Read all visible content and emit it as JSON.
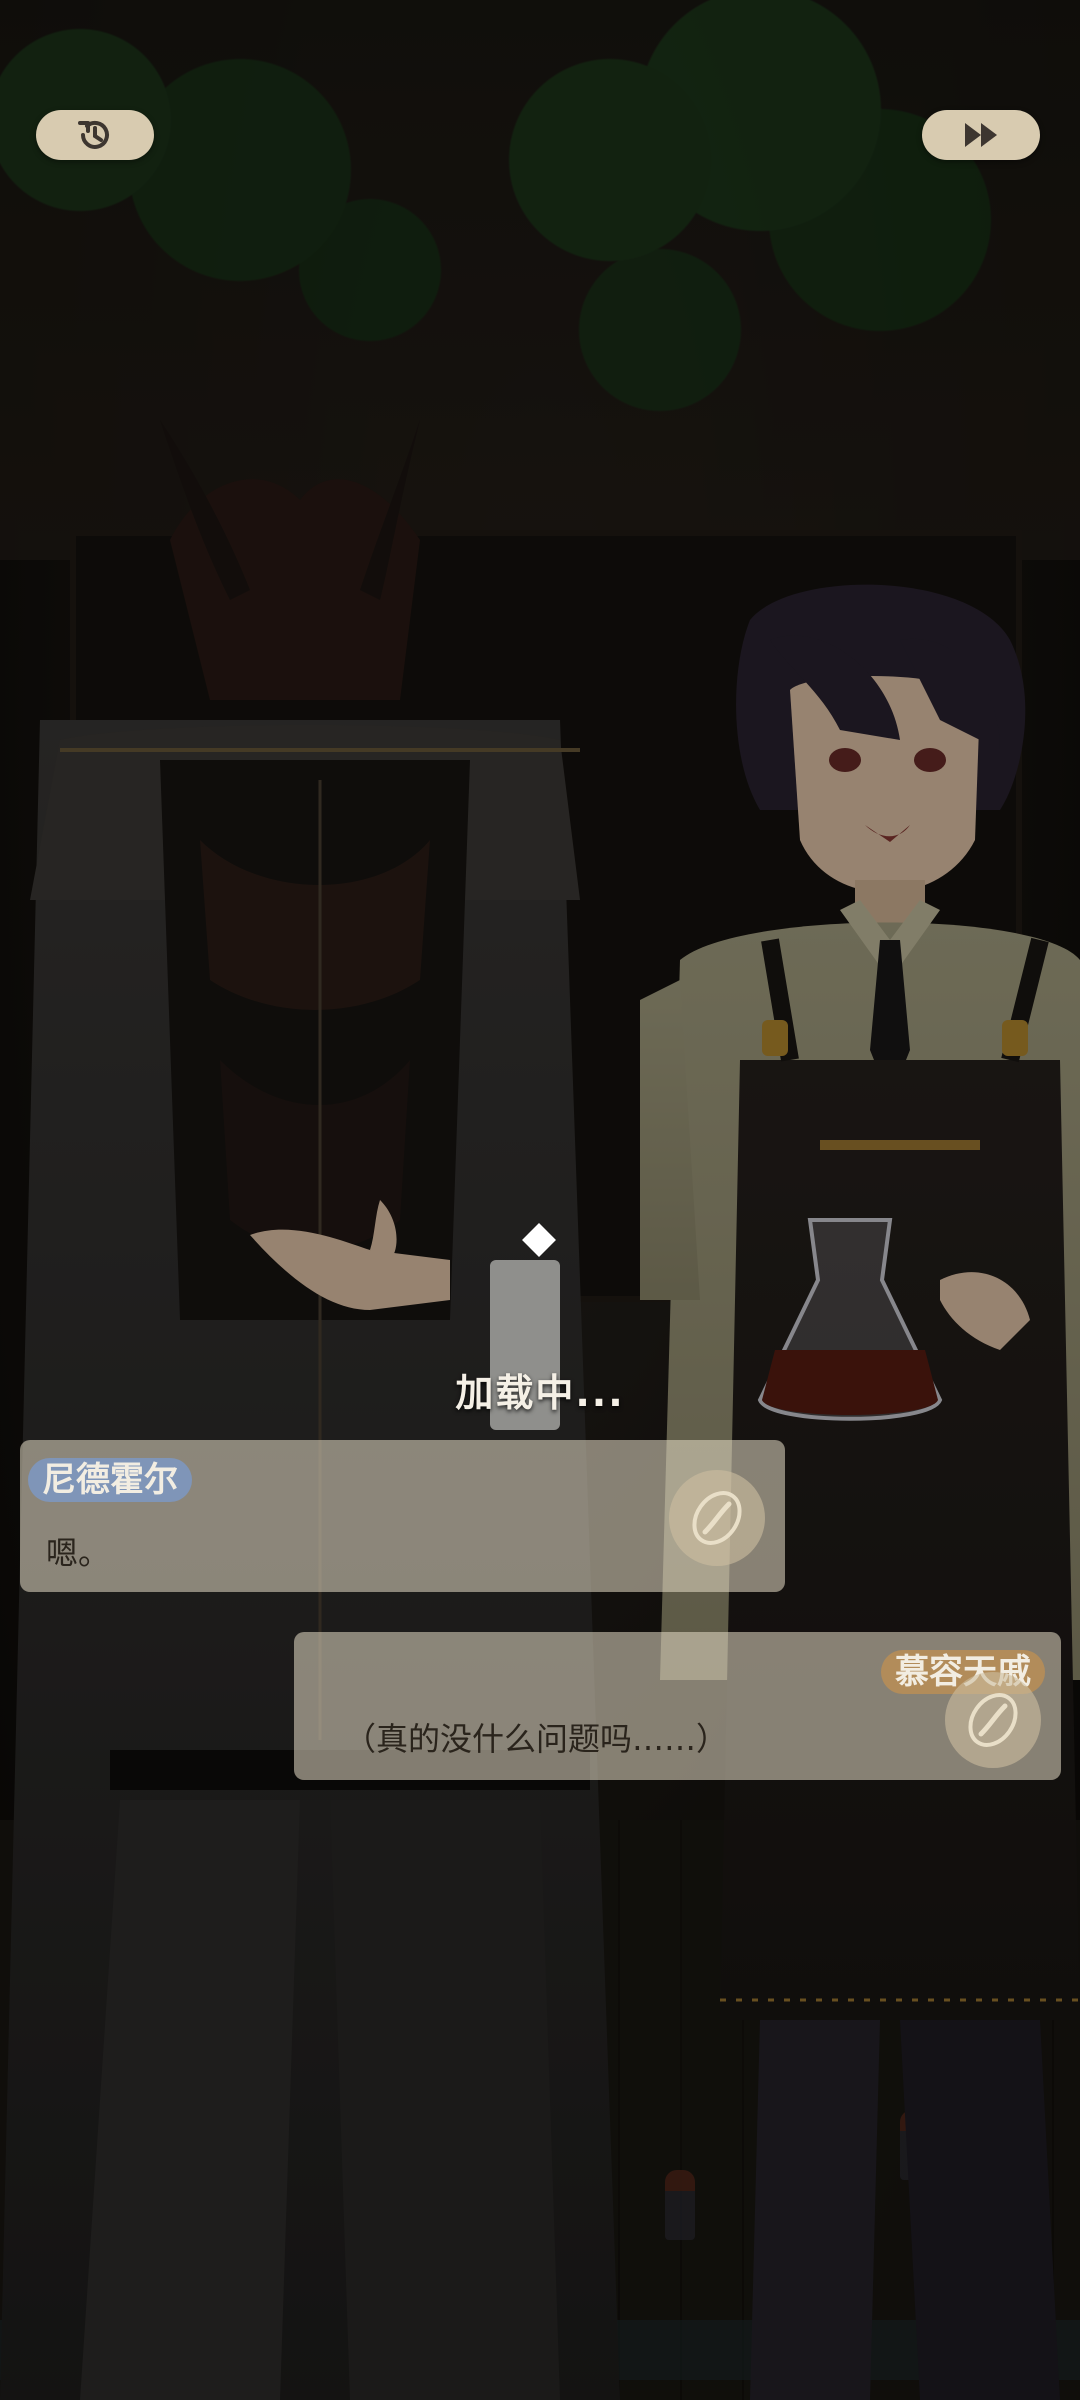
{
  "topbar": {
    "history_icon": "history-icon",
    "skip_icon": "fast-forward-icon"
  },
  "loading": {
    "text": "加载中..."
  },
  "dialogues": [
    {
      "speaker": "尼德霍尔",
      "text": "嗯。",
      "name_color": "#7f95b8"
    },
    {
      "speaker": "慕容天戚",
      "text": "（真的没什么问题吗……）",
      "name_color": "#b28c5a"
    }
  ],
  "colors": {
    "button_bg": "#d8cbb0",
    "dialog_bg": "#e8dec8",
    "loading_text": "#f5f0e6"
  }
}
